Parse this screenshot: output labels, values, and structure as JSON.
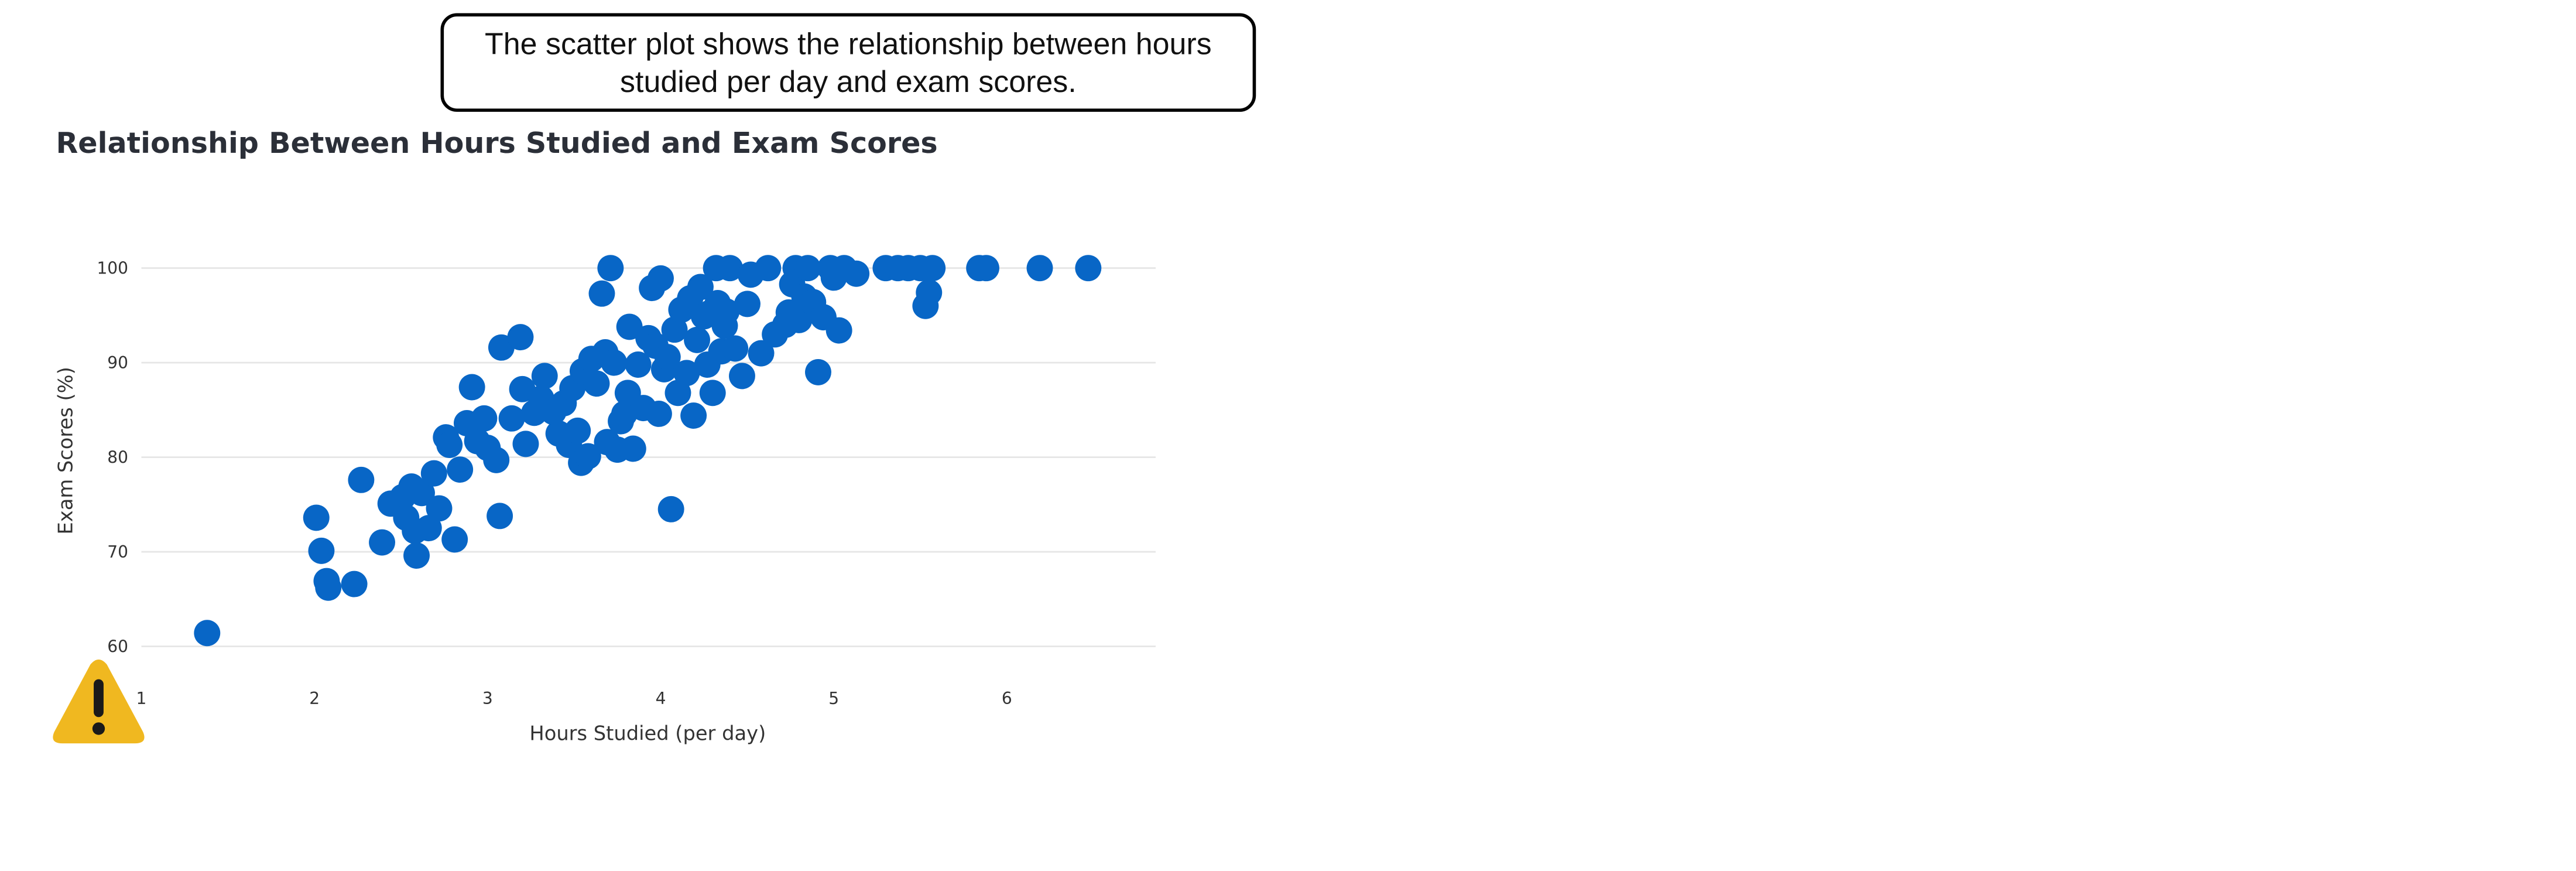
{
  "callout": {
    "text": "The scatter plot shows the relationship between hours studied per day and exam scores."
  },
  "chart_data": {
    "type": "scatter",
    "title": "Relationship Between Hours Studied and Exam Scores",
    "xlabel": "Hours Studied (per day)",
    "ylabel": "Exam Scores (%)",
    "xlim": [
      1,
      6.85
    ],
    "ylim": [
      59,
      103
    ],
    "xticks": [
      1,
      2,
      3,
      4,
      5,
      6
    ],
    "yticks": [
      60,
      70,
      80,
      90,
      100
    ],
    "grid": "horizontal",
    "marker_color": "#0866c6",
    "points": [
      [
        1.38,
        61.4
      ],
      [
        2.01,
        73.6
      ],
      [
        2.04,
        70.1
      ],
      [
        2.07,
        66.9
      ],
      [
        2.08,
        66.2
      ],
      [
        2.23,
        66.6
      ],
      [
        2.27,
        77.6
      ],
      [
        2.39,
        71.0
      ],
      [
        2.44,
        75.1
      ],
      [
        2.51,
        75.8
      ],
      [
        2.53,
        73.6
      ],
      [
        2.56,
        76.9
      ],
      [
        2.58,
        72.2
      ],
      [
        2.59,
        69.6
      ],
      [
        2.62,
        76.2
      ],
      [
        2.66,
        72.5
      ],
      [
        2.69,
        78.3
      ],
      [
        2.72,
        74.6
      ],
      [
        2.76,
        82.1
      ],
      [
        2.78,
        81.3
      ],
      [
        2.81,
        71.3
      ],
      [
        2.84,
        78.7
      ],
      [
        2.88,
        83.6
      ],
      [
        2.91,
        87.4
      ],
      [
        2.94,
        81.7
      ],
      [
        2.98,
        84.1
      ],
      [
        3.0,
        81.0
      ],
      [
        3.05,
        79.7
      ],
      [
        3.07,
        73.8
      ],
      [
        3.08,
        91.6
      ],
      [
        3.14,
        84.1
      ],
      [
        3.19,
        92.7
      ],
      [
        3.2,
        87.2
      ],
      [
        3.22,
        81.4
      ],
      [
        3.27,
        84.7
      ],
      [
        3.31,
        86.2
      ],
      [
        3.33,
        88.6
      ],
      [
        3.38,
        84.8
      ],
      [
        3.41,
        82.5
      ],
      [
        3.44,
        85.7
      ],
      [
        3.47,
        81.3
      ],
      [
        3.49,
        87.3
      ],
      [
        3.52,
        82.8
      ],
      [
        3.54,
        79.4
      ],
      [
        3.55,
        89.1
      ],
      [
        3.58,
        80.1
      ],
      [
        3.6,
        90.4
      ],
      [
        3.63,
        87.8
      ],
      [
        3.66,
        97.3
      ],
      [
        3.68,
        91.1
      ],
      [
        3.69,
        81.6
      ],
      [
        3.71,
        100.0
      ],
      [
        3.73,
        90.0
      ],
      [
        3.75,
        80.8
      ],
      [
        3.77,
        83.8
      ],
      [
        3.79,
        84.6
      ],
      [
        3.81,
        86.8
      ],
      [
        3.82,
        93.8
      ],
      [
        3.84,
        80.9
      ],
      [
        3.87,
        89.8
      ],
      [
        3.9,
        85.2
      ],
      [
        3.93,
        92.6
      ],
      [
        3.95,
        97.9
      ],
      [
        3.97,
        91.8
      ],
      [
        3.99,
        84.6
      ],
      [
        4.0,
        98.9
      ],
      [
        4.02,
        89.3
      ],
      [
        4.04,
        90.6
      ],
      [
        4.06,
        74.5
      ],
      [
        4.08,
        93.5
      ],
      [
        4.1,
        86.8
      ],
      [
        4.12,
        95.6
      ],
      [
        4.15,
        88.9
      ],
      [
        4.17,
        96.8
      ],
      [
        4.19,
        84.4
      ],
      [
        4.21,
        92.4
      ],
      [
        4.23,
        98.0
      ],
      [
        4.25,
        94.9
      ],
      [
        4.27,
        89.8
      ],
      [
        4.29,
        95.3
      ],
      [
        4.3,
        86.8
      ],
      [
        4.32,
        100.0
      ],
      [
        4.33,
        96.3
      ],
      [
        4.35,
        91.2
      ],
      [
        4.37,
        93.9
      ],
      [
        4.38,
        95.4
      ],
      [
        4.4,
        100.0
      ],
      [
        4.43,
        91.5
      ],
      [
        4.47,
        88.6
      ],
      [
        4.5,
        96.2
      ],
      [
        4.52,
        99.3
      ],
      [
        4.58,
        91.0
      ],
      [
        4.62,
        100.0
      ],
      [
        4.66,
        93.0
      ],
      [
        4.72,
        94.0
      ],
      [
        4.74,
        95.3
      ],
      [
        4.76,
        98.3
      ],
      [
        4.78,
        100.0
      ],
      [
        4.8,
        94.5
      ],
      [
        4.83,
        97.0
      ],
      [
        4.85,
        100.0
      ],
      [
        4.88,
        96.4
      ],
      [
        4.91,
        89.0
      ],
      [
        4.94,
        94.8
      ],
      [
        4.98,
        100.0
      ],
      [
        5.0,
        99.0
      ],
      [
        5.03,
        93.4
      ],
      [
        5.06,
        100.0
      ],
      [
        5.13,
        99.4
      ],
      [
        5.3,
        100.0
      ],
      [
        5.37,
        100.0
      ],
      [
        5.43,
        100.0
      ],
      [
        5.5,
        100.0
      ],
      [
        5.53,
        96.0
      ],
      [
        5.55,
        97.4
      ],
      [
        5.57,
        100.0
      ],
      [
        5.84,
        100.0
      ],
      [
        5.88,
        100.0
      ],
      [
        6.19,
        100.0
      ],
      [
        6.47,
        100.0
      ]
    ]
  },
  "warning_icon": {
    "name": "warning-icon",
    "color": "#f0b820"
  }
}
